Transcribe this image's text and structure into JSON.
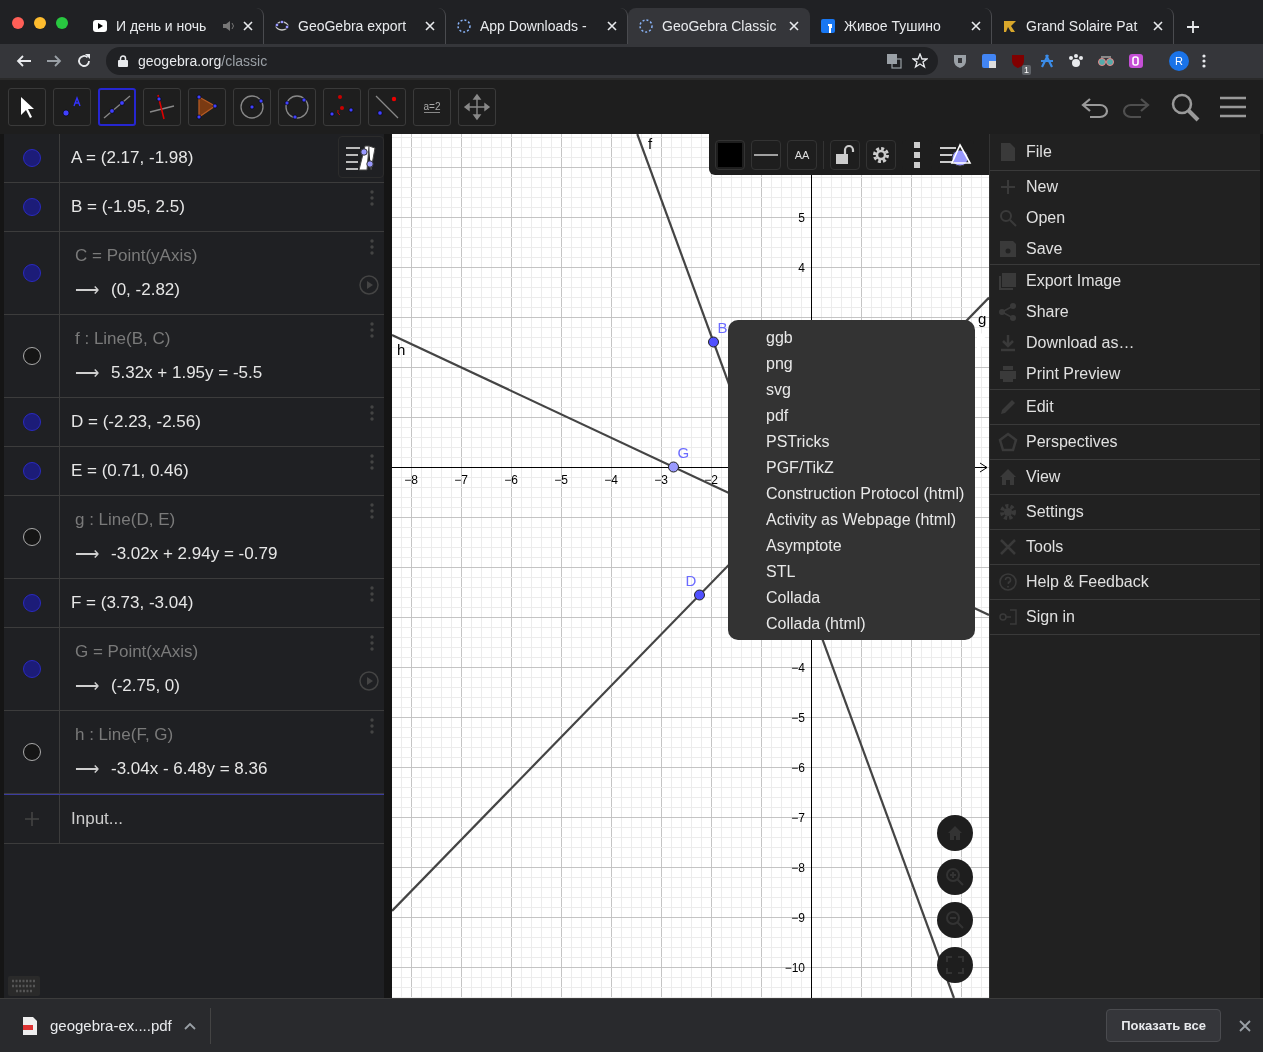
{
  "browser": {
    "tabs": [
      {
        "title": "И день и ночь",
        "selected": false,
        "audio": true
      },
      {
        "title": "GeoGebra export",
        "selected": false,
        "audio": false
      },
      {
        "title": "App Downloads -",
        "selected": false,
        "audio": false
      },
      {
        "title": "GeoGebra Classic",
        "selected": true,
        "audio": false
      },
      {
        "title": "Живое Тушино",
        "selected": false,
        "audio": false
      },
      {
        "title": "Grand Solaire Pat",
        "selected": false,
        "audio": false
      }
    ],
    "address": {
      "host": "geogebra.org",
      "path": "/classic"
    },
    "extension_badge": "1",
    "profile_initial": "R"
  },
  "toolbar": {
    "tools": [
      {
        "selected": false
      },
      {
        "selected": false
      },
      {
        "selected": true
      },
      {
        "selected": false
      },
      {
        "selected": false
      },
      {
        "selected": false
      },
      {
        "selected": false
      },
      {
        "selected": false
      },
      {
        "selected": false
      },
      {
        "selected": false,
        "label": "a=2"
      },
      {
        "selected": false
      }
    ],
    "undo": {
      "disabled": false
    },
    "redo": {
      "disabled": true
    }
  },
  "algebra": {
    "rows": [
      {
        "kind": "point",
        "value": "A = (2.17, -1.98)"
      },
      {
        "kind": "point",
        "value": "B = (-1.95, 2.5)"
      },
      {
        "kind": "point_on_path",
        "definition": "C = Point(yAxis)",
        "arrow": "⟶",
        "value": "(0, -2.82)"
      },
      {
        "kind": "line",
        "definition": "f : Line(B, C)",
        "arrow": "⟶",
        "value": "5.32x + 1.95y = -5.5"
      },
      {
        "kind": "point",
        "value": "D = (-2.23, -2.56)"
      },
      {
        "kind": "point",
        "value": "E = (0.71, 0.46)"
      },
      {
        "kind": "line",
        "definition": "g : Line(D, E)",
        "arrow": "⟶",
        "value": "-3.02x + 2.94y = -0.79"
      },
      {
        "kind": "point",
        "value": "F = (3.73, -3.04)"
      },
      {
        "kind": "point_on_path",
        "definition": "G = Point(xAxis)",
        "arrow": "⟶",
        "value": "(-2.75, 0)"
      },
      {
        "kind": "line",
        "definition": "h : Line(F, G)",
        "arrow": "⟶",
        "value": "-3.04x - 6.48y = 8.36"
      }
    ],
    "input_placeholder": "Input..."
  },
  "graphics": {
    "x_tick_labels": [
      "−8",
      "−7",
      "−6",
      "−5",
      "−4",
      "−3",
      "−2"
    ],
    "y_tick_labels": [
      "5",
      "4",
      "−4",
      "−5",
      "−6",
      "−7",
      "−8",
      "−9",
      "−10"
    ],
    "line_labels": [
      "f",
      "h",
      "g"
    ],
    "points": [
      {
        "label": "B"
      },
      {
        "label": "G"
      },
      {
        "label": "D"
      }
    ],
    "style_bar": {
      "text_button": "AA"
    },
    "export_menu": [
      "ggb",
      "png",
      "svg",
      "pdf",
      "PSTricks",
      "PGF/TikZ",
      "Construction Protocol (html)",
      "Activity as Webpage (html)",
      "Asymptote",
      "STL",
      "Collada",
      "Collada (html)"
    ]
  },
  "main_menu": {
    "title": "File",
    "groups": [
      [
        "New",
        "Open",
        "Save"
      ],
      [
        "Export Image",
        "Share",
        "Download as…",
        "Print Preview"
      ],
      [
        "Edit"
      ],
      [
        "Perspectives"
      ],
      [
        "View"
      ],
      [
        "Settings"
      ],
      [
        "Tools"
      ],
      [
        "Help & Feedback"
      ],
      [
        "Sign in"
      ]
    ]
  },
  "download_bar": {
    "file": "geogebra-ex....pdf",
    "show_all": "Показать все"
  }
}
